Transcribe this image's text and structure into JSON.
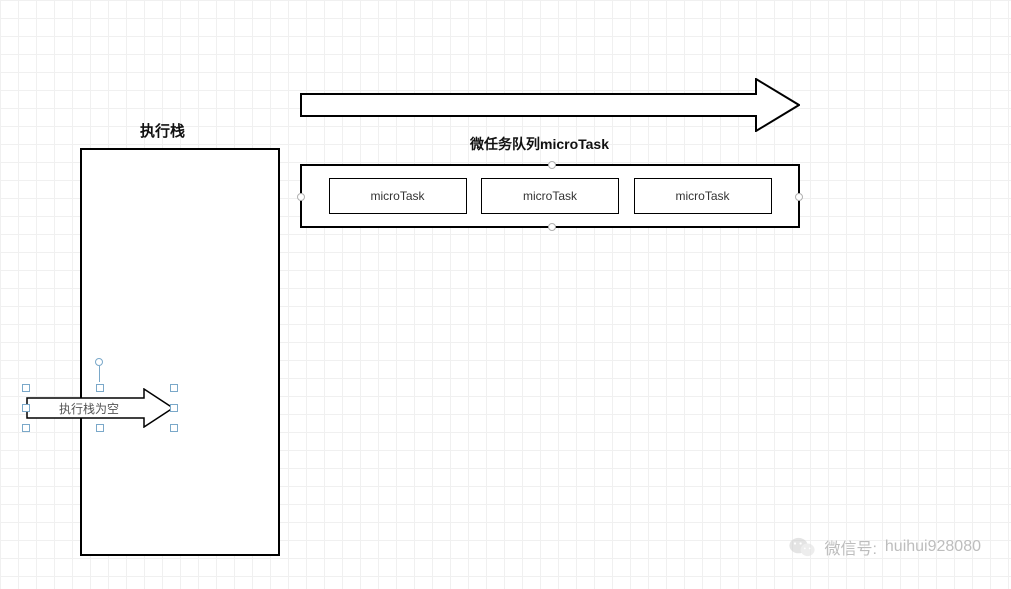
{
  "stack": {
    "label": "执行栈",
    "empty_arrow_text": "执行栈为空"
  },
  "queue": {
    "label": "微任务队列microTask",
    "items": [
      {
        "label": "microTask"
      },
      {
        "label": "microTask"
      },
      {
        "label": "microTask"
      }
    ]
  },
  "watermark": {
    "prefix": "微信号:",
    "id": "huihui928080"
  }
}
